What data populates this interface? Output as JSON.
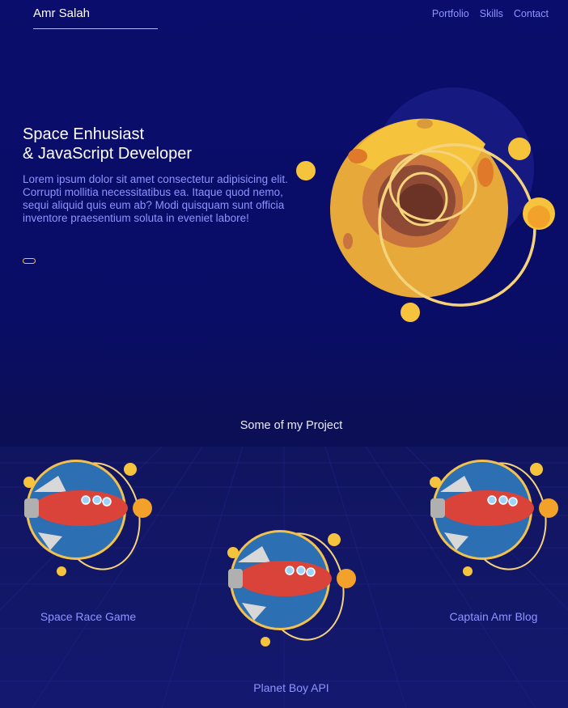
{
  "header": {
    "brand": "Amr Salah",
    "nav": [
      {
        "label": "Portfolio"
      },
      {
        "label": "Skills"
      },
      {
        "label": "Contact"
      }
    ]
  },
  "hero": {
    "title_line1": "Space Enhusiast",
    "title_line2": "& JavaScript Developer",
    "text": "Lorem ipsum dolor sit amet consectetur adipisicing elit. Corrupti mollitia necessitatibus ea. Itaque quod nemo, sequi aliquid quis eum ab? Modi quisquam sunt officia inventore praesentium soluta in eveniet labore!",
    "button_label": ""
  },
  "projects": {
    "title": "Some of my Project",
    "items": [
      {
        "name": "Space Race Game"
      },
      {
        "name": "Planet Boy API"
      },
      {
        "name": "Captain Amr Blog"
      }
    ]
  },
  "colors": {
    "background": "#0b0e63",
    "accent": "#f2c14e",
    "link": "#8f95ff"
  }
}
